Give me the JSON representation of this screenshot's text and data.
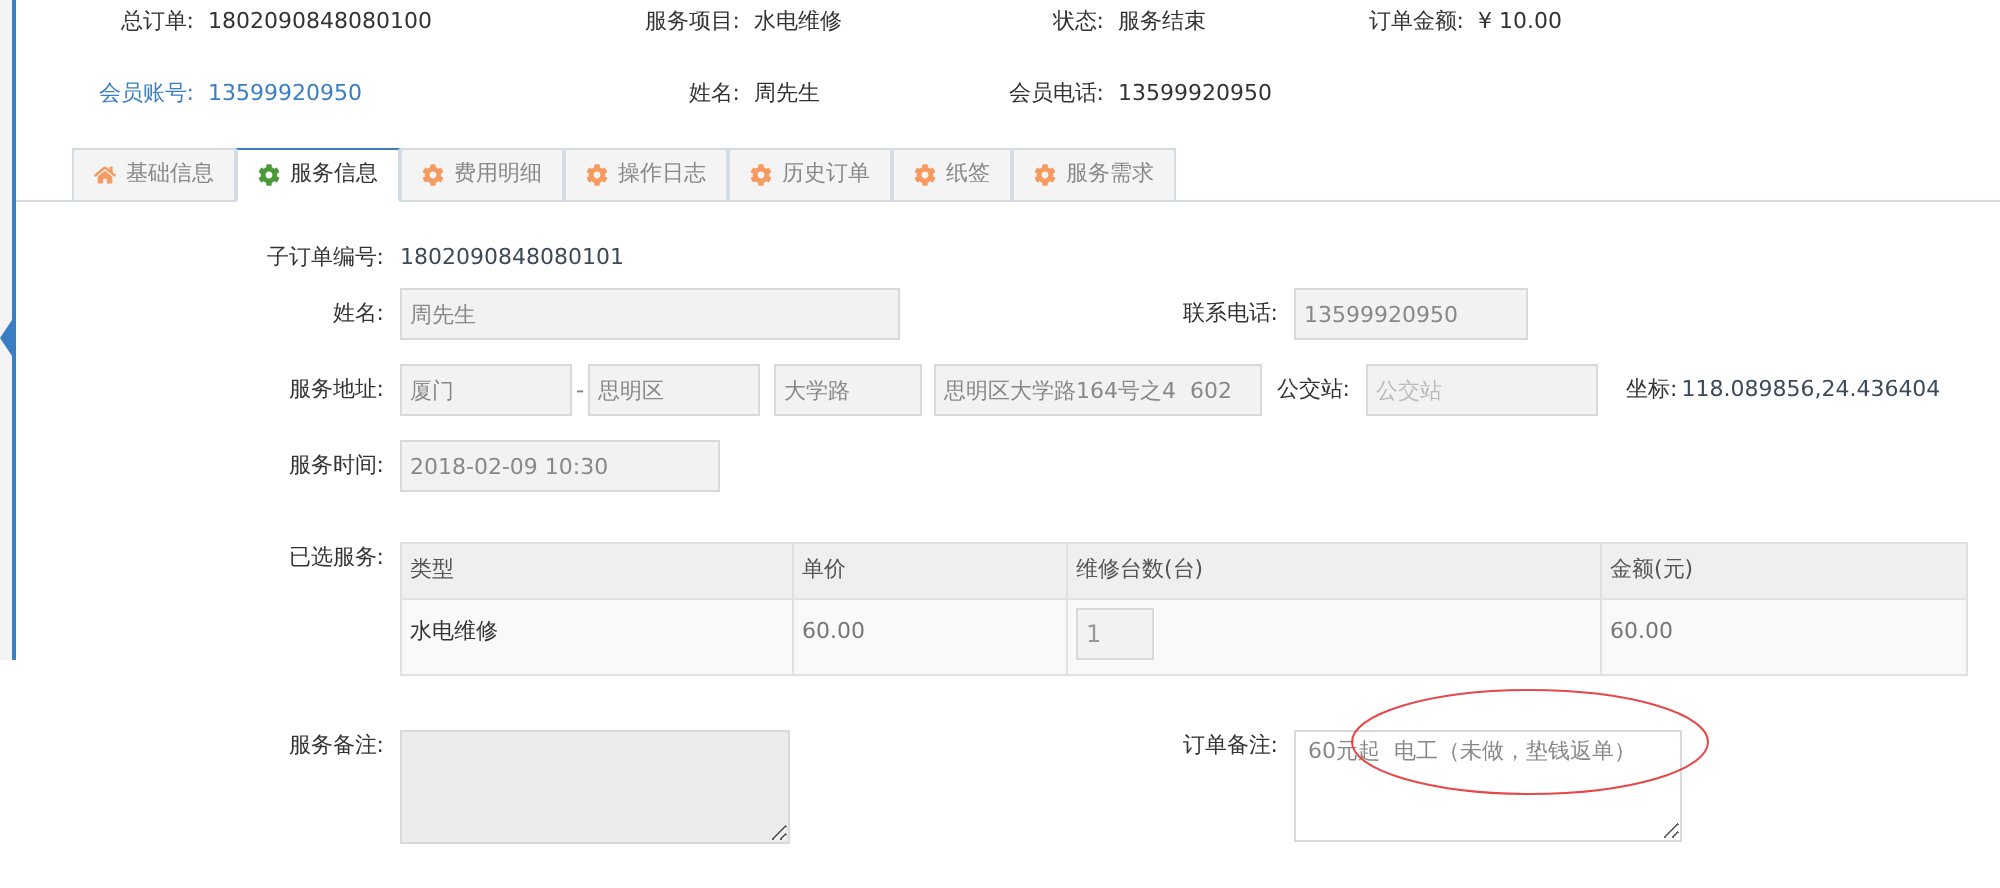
{
  "header": [
    {
      "label": "总订单:",
      "value": "1802090848080100",
      "kind": "plain"
    },
    {
      "label": "服务项目:",
      "value": "水电维修",
      "kind": "plain"
    },
    {
      "label": "状态:",
      "value": "服务结束",
      "kind": "plain"
    },
    {
      "label": "订单金额:",
      "value": "¥ 10.00",
      "kind": "plain"
    },
    {
      "label": "会员账号:",
      "value": "13599920950",
      "kind": "link"
    },
    {
      "label": "姓名:",
      "value": "周先生",
      "kind": "plain"
    },
    {
      "label": "会员电话:",
      "value": "13599920950",
      "kind": "plain"
    }
  ],
  "tabs": [
    {
      "label": "基础信息",
      "kind": "home",
      "selected": false
    },
    {
      "label": "服务信息",
      "kind": "settings",
      "selected": true
    },
    {
      "label": "费用明细",
      "kind": "settings",
      "selected": false
    },
    {
      "label": "操作日志",
      "kind": "settings",
      "selected": false
    },
    {
      "label": "历史订单",
      "kind": "settings",
      "selected": false
    },
    {
      "label": "纸签",
      "kind": "settings",
      "selected": false
    },
    {
      "label": "服务需求",
      "kind": "settings",
      "selected": false
    }
  ],
  "form": {
    "sub_order": {
      "label": "子订单编号:",
      "value": "1802090848080101"
    },
    "name": {
      "label": "姓名:",
      "value": "周先生"
    },
    "phone": {
      "label": "联系电话:",
      "value": "13599920950"
    },
    "address": {
      "label": "服务地址:",
      "city": "厦门",
      "separator": "-",
      "district": "思明区",
      "road": "大学路",
      "detail": "思明区大学路164号之4  602"
    },
    "bus": {
      "label": "公交站:",
      "placeholder": "公交站"
    },
    "coords": {
      "label": "坐标:",
      "value": "118.089856,24.436404"
    },
    "time": {
      "label": "服务时间:",
      "value": "2018-02-09 10:30"
    },
    "services": {
      "label": "已选服务:",
      "columns": [
        "类型",
        "单价",
        "维修台数(台)",
        "金额(元)"
      ],
      "rows": [
        {
          "type": "水电维修",
          "price": "60.00",
          "count": "1",
          "amount": "60.00"
        }
      ]
    },
    "service_note": {
      "label": "服务备注:"
    },
    "order_note": {
      "label": "订单备注:",
      "value": "60元起  电工（未做，垫钱返单）",
      "annotated": true
    }
  }
}
